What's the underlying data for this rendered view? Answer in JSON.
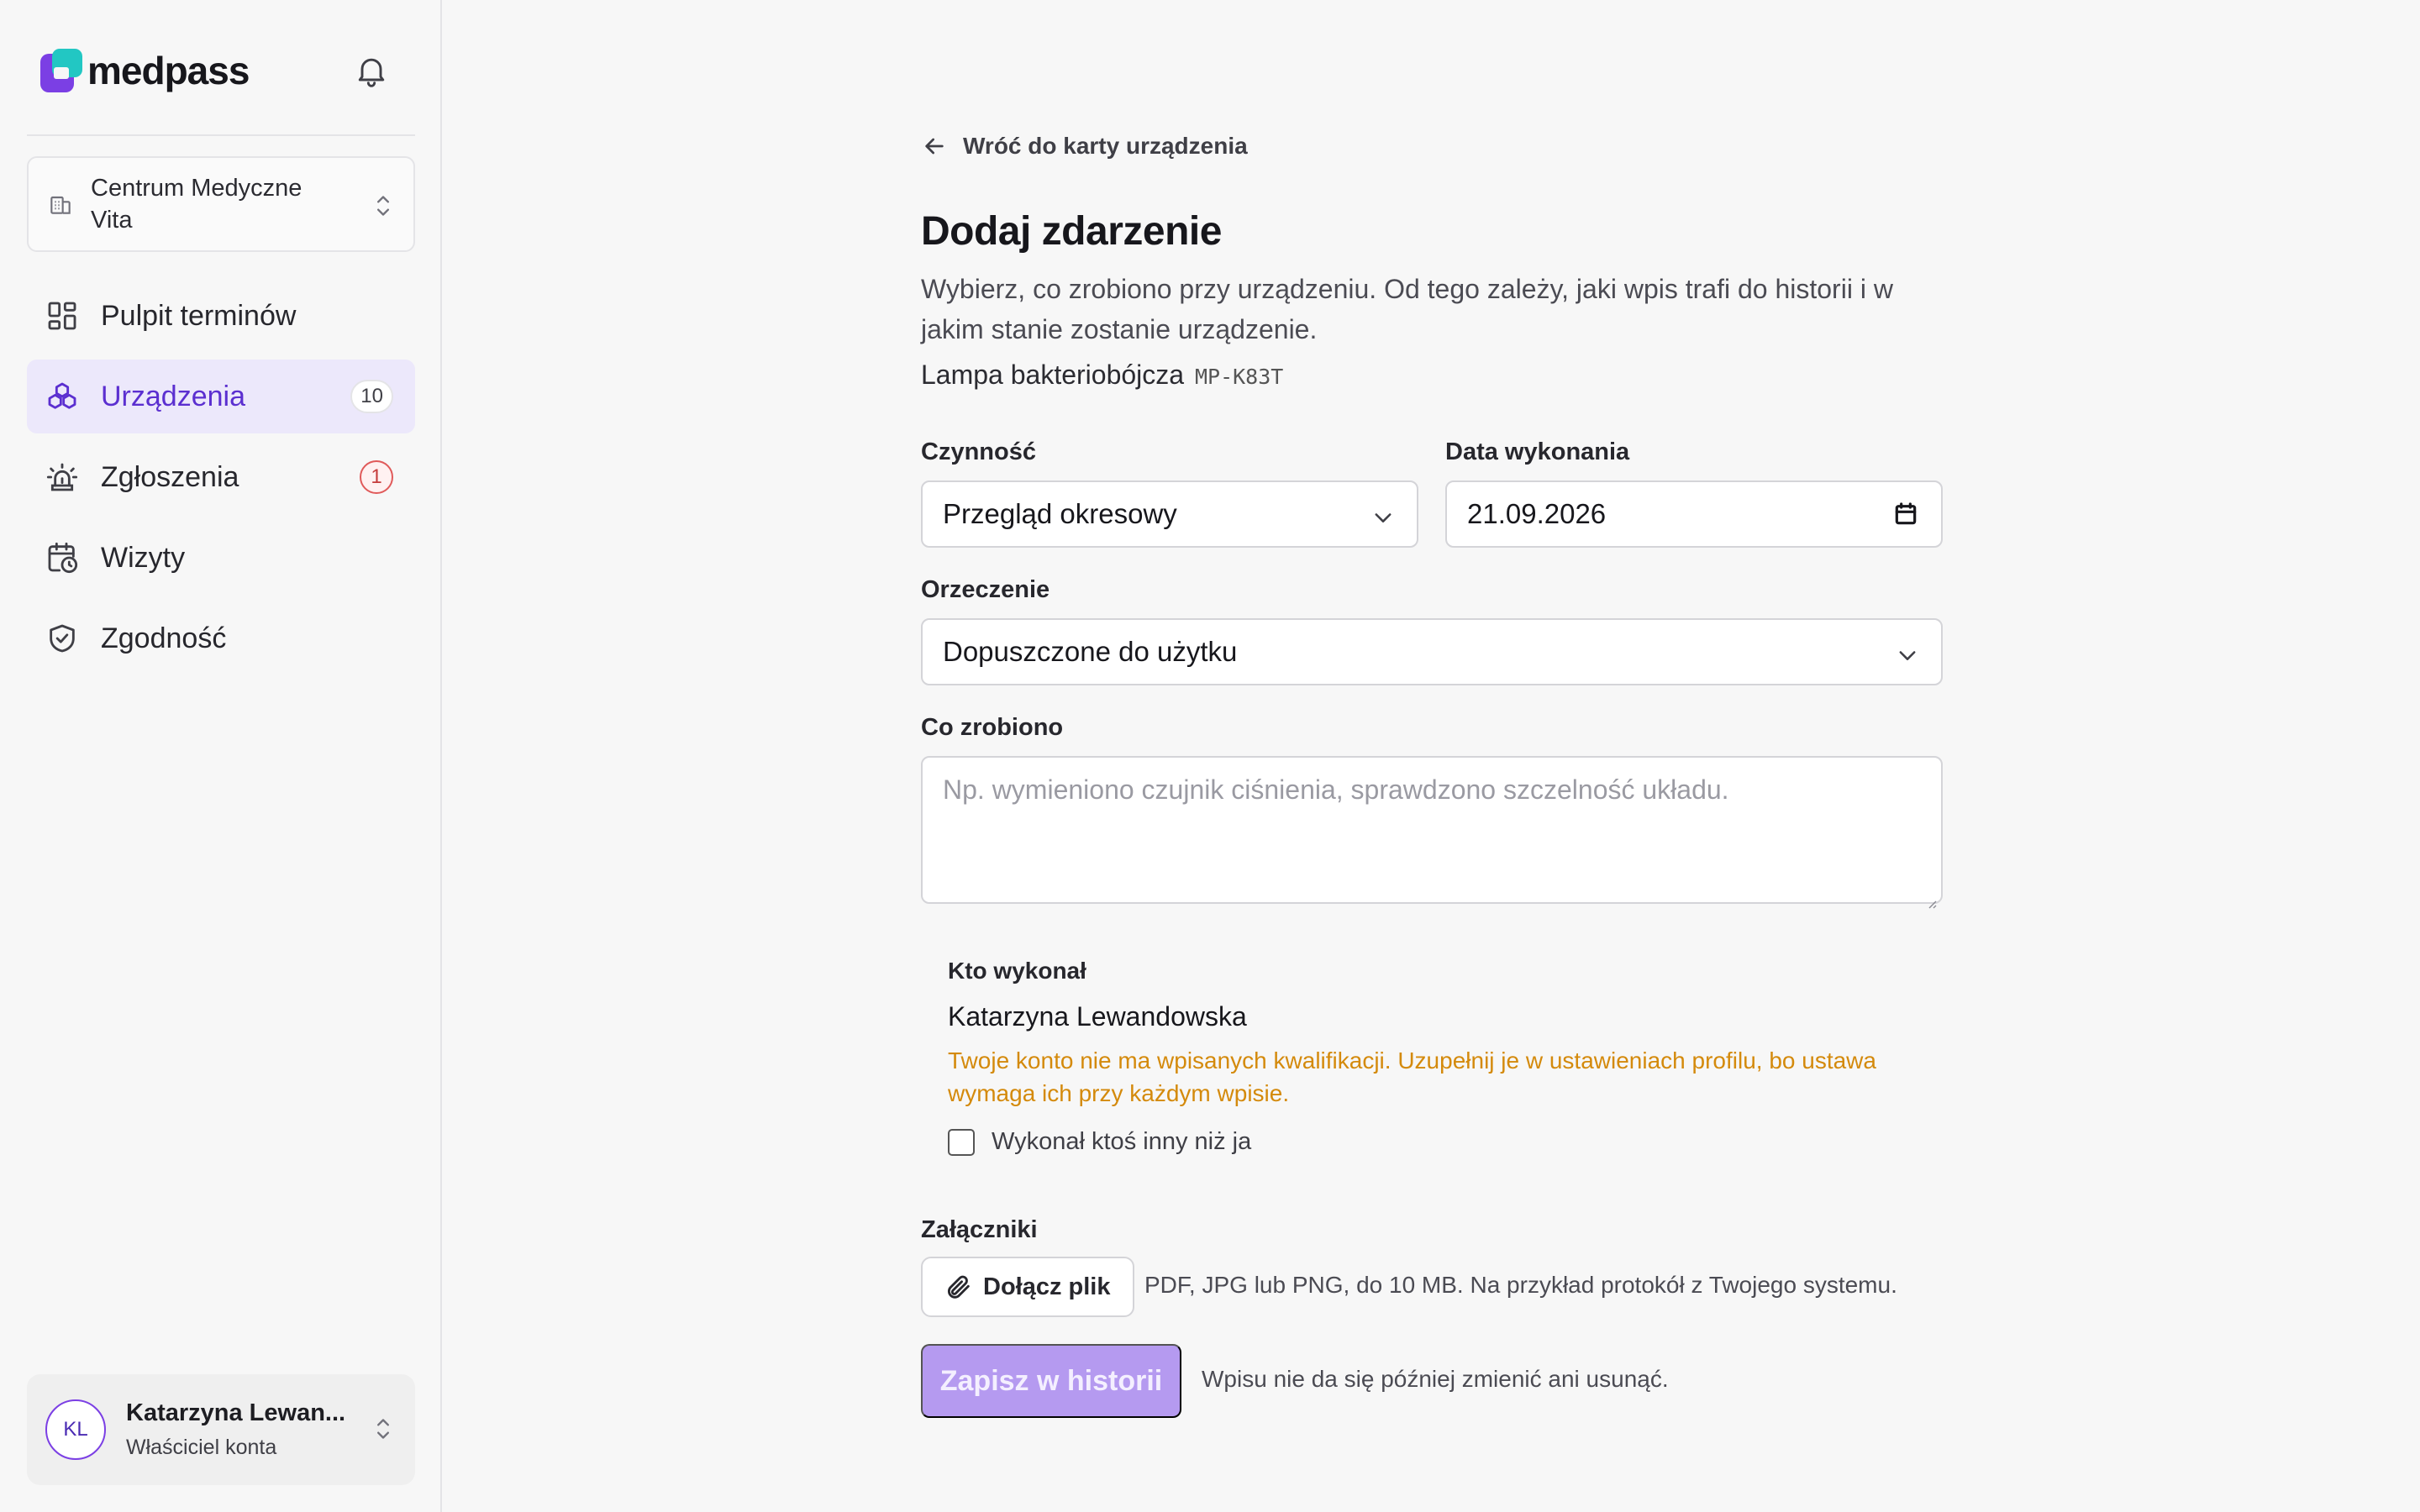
{
  "brand": {
    "name": "medpass",
    "colors": {
      "primary": "#7b3fe4",
      "secondary": "#22c7c3"
    }
  },
  "header": {
    "notifications_icon": "bell-icon"
  },
  "organization": {
    "name": "Centrum Medyczne Vita",
    "icon": "building-icon"
  },
  "sidebar": {
    "items": [
      {
        "label": "Pulpit terminów",
        "icon": "dashboard-icon",
        "active": false,
        "badge": ""
      },
      {
        "label": "Urządzenia",
        "icon": "devices-icon",
        "active": true,
        "badge": "10"
      },
      {
        "label": "Zgłoszenia",
        "icon": "alarm-icon",
        "active": false,
        "badge": "1"
      },
      {
        "label": "Wizyty",
        "icon": "calendar-clock-icon",
        "active": false,
        "badge": ""
      },
      {
        "label": "Zgodność",
        "icon": "shield-check-icon",
        "active": false,
        "badge": ""
      }
    ]
  },
  "user": {
    "initials": "KL",
    "name": "Katarzyna Lewan...",
    "role": "Właściciel konta"
  },
  "page": {
    "back_label": "Wróć do karty urządzenia",
    "title": "Dodaj zdarzenie",
    "description": "Wybierz, co zrobiono przy urządzeniu. Od tego zależy, jaki wpis trafi do historii i w jakim stanie zostanie urządzenie.",
    "device_name": "Lampa bakteriobójcza",
    "device_code": "MP-K83T"
  },
  "form": {
    "activity": {
      "label": "Czynność",
      "value": "Przegląd okresowy"
    },
    "date": {
      "label": "Data wykonania",
      "value": "21.09.2026"
    },
    "verdict": {
      "label": "Orzeczenie",
      "value": "Dopuszczone do użytku"
    },
    "notes": {
      "label": "Co zrobiono",
      "placeholder": "Np. wymieniono czujnik ciśnienia, sprawdzono szczelność układu."
    },
    "performer": {
      "label": "Kto wykonał",
      "name": "Katarzyna Lewandowska",
      "warning": "Twoje konto nie ma wpisanych kwalifikacji. Uzupełnij je w ustawieniach profilu, bo ustawa wymaga ich przy każdym wpisie.",
      "other_label": "Wykonał ktoś inny niż ja",
      "other_checked": false
    },
    "attachments": {
      "label": "Załączniki",
      "button": "Dołącz plik",
      "hint": "PDF, JPG lub PNG, do 10 MB. Na przykład protokół z Twojego systemu."
    },
    "submit": {
      "label": "Zapisz w historii",
      "hint": "Wpisu nie da się później zmienić ani usunąć."
    }
  }
}
